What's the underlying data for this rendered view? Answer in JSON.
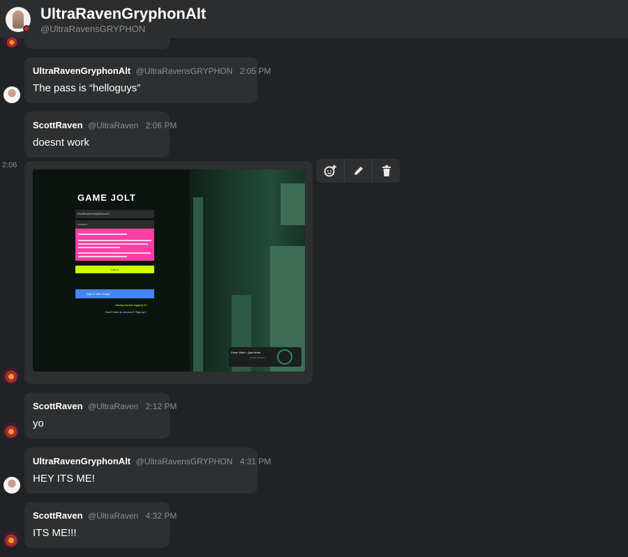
{
  "header": {
    "name": "UltraRavenGryphonAlt",
    "handle": "@UltraRavensGRYPHON"
  },
  "messages": [
    {
      "name": "UltraRavenGryphonAlt",
      "handle": "@UltraRavensGRYPHON",
      "time": "2:05 PM",
      "text": "The pass is “helloguys”"
    },
    {
      "name": "ScottRaven",
      "handle": "@UltraRaven",
      "time": "2:06 PM",
      "text": "doesnt work"
    },
    {
      "name": "ScottRaven",
      "handle": "@UltraRaven",
      "time": "2:12 PM",
      "text": "yo"
    },
    {
      "name": "UltraRavenGryphonAlt",
      "handle": "@UltraRavensGRYPHON",
      "time": "4:31 PM",
      "text": "HEY ITS ME!"
    },
    {
      "name": "ScottRaven",
      "handle": "@UltraRaven",
      "time": "4:32 PM",
      "text": "ITS ME!!!"
    }
  ],
  "image_message": {
    "hover_time": "2:06"
  },
  "screenshot": {
    "logo": "GAME JOLT",
    "username": "FiveBearsFamilyDiner823",
    "password": "••••••••••",
    "login": "Log in",
    "google": "Sign in with Google",
    "trouble": "Having trouble logging in?",
    "signup": "Don't have an account? Sign up!",
    "badge_title": "Down Ward - (jam beta)",
    "badge_sub": "12,965 followers"
  },
  "actions": {
    "react": "add-reaction-icon",
    "edit": "pencil-icon",
    "delete": "trash-icon"
  },
  "colors": {
    "background": "#202224",
    "bubble": "#2d2f31",
    "header": "#2b2d2f",
    "status": "#e8202a"
  }
}
